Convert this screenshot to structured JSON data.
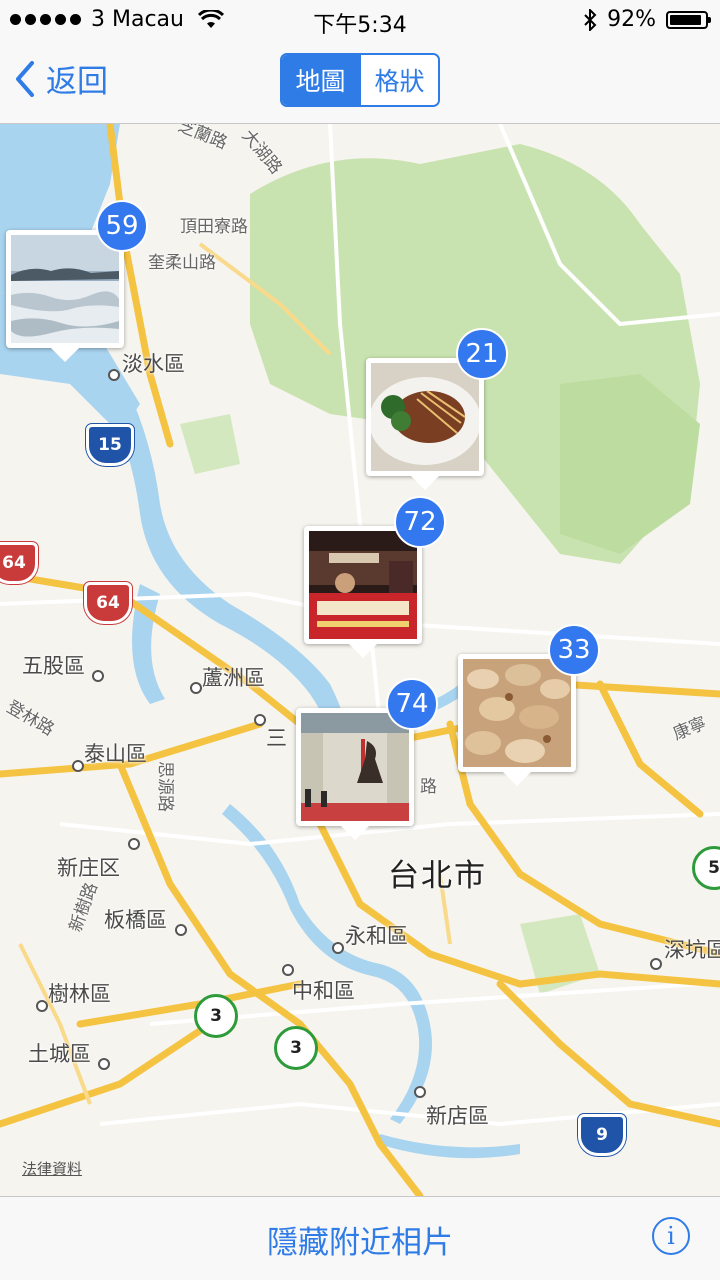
{
  "status_bar": {
    "carrier": "3 Macau",
    "time": "下午5:34",
    "battery_percent": "92%",
    "battery_level": 0.92,
    "icons": [
      "signal-dots-icon",
      "wifi-icon",
      "bluetooth-icon",
      "battery-icon"
    ]
  },
  "nav": {
    "back_label": "返回",
    "segments": [
      {
        "label": "地圖",
        "selected": true
      },
      {
        "label": "格狀",
        "selected": false
      }
    ]
  },
  "map": {
    "place_labels": {
      "danshui": "淡水區",
      "wugu": "五股區",
      "luzhou": "蘆洲區",
      "taishan": "泰山區",
      "xinzhuang": "新庄区",
      "banqiao": "板橋區",
      "shulin": "樹林區",
      "tucheng": "土城區",
      "yonghe": "永和區",
      "zhonghe": "中和區",
      "xindian": "新店區",
      "shenkeng": "深坑區",
      "taipei": "台北市",
      "sanchong_partial": "三"
    },
    "road_labels": {
      "zhilan": "芝蘭路",
      "dahu": "大湖路",
      "dingtianliao": "頂田寮路",
      "kuiroushan": "奎柔山路",
      "denglin": "登林路",
      "siyuan": "思源路",
      "xinshu": "新樹路",
      "kangning": "康寧",
      "road_fragment": "路"
    },
    "shields": {
      "s15": "15",
      "s64a": "64",
      "s64b": "64",
      "s9": "9",
      "s3a": "3",
      "s3b": "3",
      "s5": "5"
    },
    "legal_link": "法律資料",
    "photo_clusters": [
      {
        "count": "59",
        "subject": "sea-waves"
      },
      {
        "count": "21",
        "subject": "noodle-dish"
      },
      {
        "count": "72",
        "subject": "night-market-stall"
      },
      {
        "count": "33",
        "subject": "fried-pastry"
      },
      {
        "count": "74",
        "subject": "memorial-hall"
      }
    ]
  },
  "toolbar": {
    "hide_nearby_label": "隱藏附近相片",
    "info_icon": "info-icon"
  },
  "colors": {
    "accent": "#2f7ce6",
    "badge": "#3478f0",
    "water": "#a9d4f0",
    "park": "#c9e3b0",
    "highway": "#f5c342",
    "land": "#f6f4ee"
  }
}
